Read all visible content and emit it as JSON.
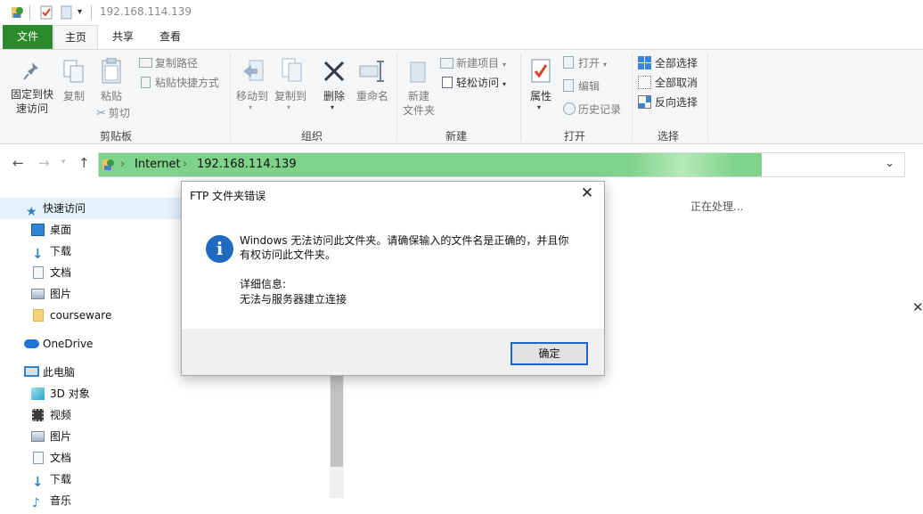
{
  "window": {
    "title": "192.168.114.139"
  },
  "tabs": [
    {
      "label": "文件"
    },
    {
      "label": "主页"
    },
    {
      "label": "共享"
    },
    {
      "label": "查看"
    }
  ],
  "ribbon": {
    "clipboard": {
      "pin": "固定到快\n速访问",
      "copy": "复制",
      "paste": "粘贴",
      "copy_path": "复制路径",
      "paste_shortcut": "粘贴快捷方式",
      "cut": "剪切",
      "group": "剪贴板"
    },
    "organize": {
      "move_to": "移动到",
      "copy_to": "复制到",
      "delete": "删除",
      "rename": "重命名",
      "group": "组织"
    },
    "new": {
      "new_folder": "新建\n文件夹",
      "new_item": "新建项目",
      "easy_access": "轻松访问",
      "group": "新建"
    },
    "open": {
      "properties": "属性",
      "open": "打开",
      "edit": "编辑",
      "history": "历史记录",
      "group": "打开"
    },
    "select": {
      "select_all": "全部选择",
      "select_none": "全部取消",
      "invert": "反向选择",
      "group": "选择"
    }
  },
  "address": {
    "crumbs": [
      "Internet",
      "192.168.114.139"
    ],
    "accent": "#7fd289"
  },
  "sidebar": {
    "items": [
      {
        "label": "快速访问",
        "icon": "star-icon"
      },
      {
        "label": "桌面",
        "icon": "desktop-icon"
      },
      {
        "label": "下载",
        "icon": "download-icon"
      },
      {
        "label": "文档",
        "icon": "document-icon"
      },
      {
        "label": "图片",
        "icon": "picture-icon"
      },
      {
        "label": "courseware",
        "icon": "folder-icon"
      },
      {
        "label": "OneDrive",
        "icon": "cloud-icon"
      },
      {
        "label": "此电脑",
        "icon": "computer-icon"
      },
      {
        "label": "3D 对象",
        "icon": "cube-icon"
      },
      {
        "label": "视频",
        "icon": "video-icon"
      },
      {
        "label": "图片",
        "icon": "picture-icon"
      },
      {
        "label": "文档",
        "icon": "document-icon"
      },
      {
        "label": "下载",
        "icon": "download-icon"
      },
      {
        "label": "音乐",
        "icon": "music-icon"
      }
    ]
  },
  "content": {
    "status": "正在处理..."
  },
  "dialog": {
    "title": "FTP 文件夹错误",
    "message": "Windows 无法访问此文件夹。请确保输入的文件名是正确的，并且你有权访问此文件夹。",
    "detail_heading": "详细信息:",
    "detail": "无法与服务器建立连接",
    "ok": "确定",
    "close_glyph": "✕",
    "info_glyph": "i"
  }
}
